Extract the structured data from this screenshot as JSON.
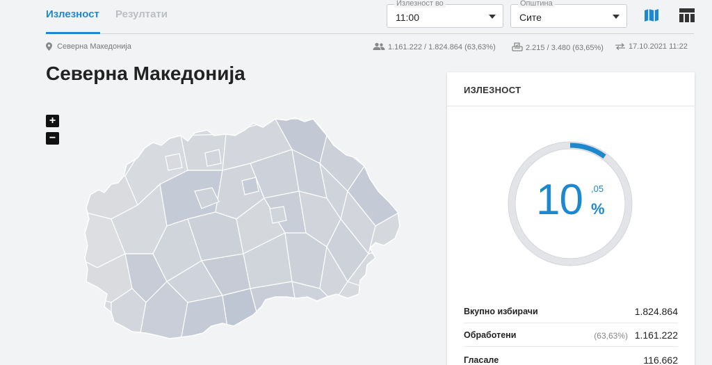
{
  "tabs": [
    {
      "label": "Излезност",
      "active": true
    },
    {
      "label": "Резултати",
      "active": false
    }
  ],
  "filters": {
    "time": {
      "label": "Излезност во",
      "value": "11:00"
    },
    "municipality": {
      "label": "Општина",
      "value": "Сите"
    }
  },
  "view_buttons": {
    "map_icon": "map-icon",
    "table_icon": "table-icon"
  },
  "info": {
    "location": "Северна Македонија",
    "voters": "1.161.222 / 1.824.864 (63,63%)",
    "stations": "2.215 / 3.480 (63,65%)",
    "updated": "17.10.2021 11:22"
  },
  "page_title": "Северна Македонија",
  "zoom": {
    "in": "+",
    "out": "−"
  },
  "panel": {
    "title": "ИЗЛЕЗНОСТ",
    "turnout": {
      "integer": "10",
      "decimal": ",05",
      "sign": "%",
      "fraction": 0.1005
    },
    "rows": [
      {
        "label": "Вкупно избирачи",
        "percent": "",
        "value": "1.824.864"
      },
      {
        "label": "Обработени",
        "percent": "(63,63%)",
        "value": "1.161.222"
      },
      {
        "label": "Гласале",
        "percent": "",
        "value": "116.662"
      }
    ]
  },
  "colors": {
    "accent": "#1e88cf",
    "map_fill": "#cdd2da",
    "map_stroke": "#ffffff"
  }
}
